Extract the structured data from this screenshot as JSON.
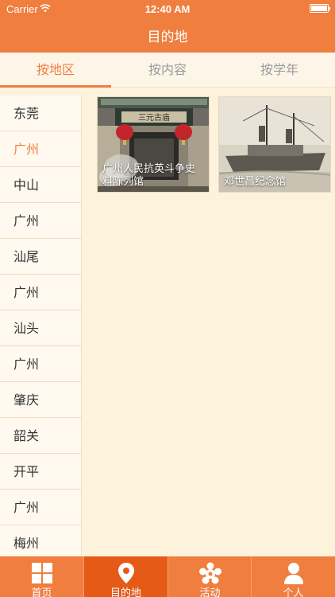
{
  "status_bar": {
    "carrier": "Carrier",
    "time": "12:40 AM"
  },
  "nav": {
    "title": "目的地"
  },
  "tabs": [
    {
      "label": "按地区"
    },
    {
      "label": "按内容"
    },
    {
      "label": "按学年"
    }
  ],
  "regions": [
    {
      "label": "东莞"
    },
    {
      "label": "广州"
    },
    {
      "label": "中山"
    },
    {
      "label": "广州"
    },
    {
      "label": "汕尾"
    },
    {
      "label": "广州"
    },
    {
      "label": "汕头"
    },
    {
      "label": "广州"
    },
    {
      "label": "肇庆"
    },
    {
      "label": "韶关"
    },
    {
      "label": "开平"
    },
    {
      "label": "广州"
    },
    {
      "label": "梅州"
    }
  ],
  "cards": [
    {
      "caption": "广州人民抗英斗争史料陈列馆"
    },
    {
      "caption": "邓世昌纪念馆"
    }
  ],
  "tabbar": [
    {
      "label": "首页",
      "icon": "home-grid-icon"
    },
    {
      "label": "目的地",
      "icon": "map-pin-icon"
    },
    {
      "label": "活动",
      "icon": "star-icon"
    },
    {
      "label": "个人",
      "icon": "person-icon"
    }
  ],
  "colors": {
    "accent": "#ef7e3f",
    "accent_dark": "#e55a17",
    "background": "#fdf2dc"
  }
}
